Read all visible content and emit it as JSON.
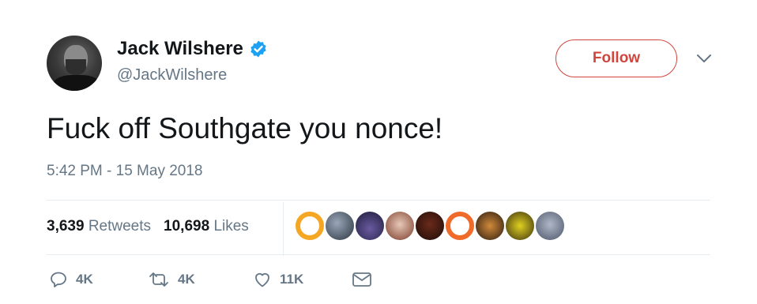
{
  "user": {
    "name": "Jack Wilshere",
    "handle": "@JackWilshere"
  },
  "follow_label": "Follow",
  "tweet": {
    "text": "Fuck off Southgate you nonce!",
    "timestamp": "5:42 PM - 15 May 2018"
  },
  "stats": {
    "retweets_count": "3,639",
    "retweets_label": "Retweets",
    "likes_count": "10,698",
    "likes_label": "Likes"
  },
  "actions": {
    "replies": "4K",
    "retweets": "4K",
    "likes": "11K"
  },
  "colors": {
    "follow_red": "#d0463f",
    "verified_blue": "#1da1f2",
    "secondary_text": "#657786"
  },
  "icons": [
    "verified-icon",
    "chevron-down-icon",
    "reply-icon",
    "retweet-icon",
    "like-icon",
    "message-icon"
  ]
}
